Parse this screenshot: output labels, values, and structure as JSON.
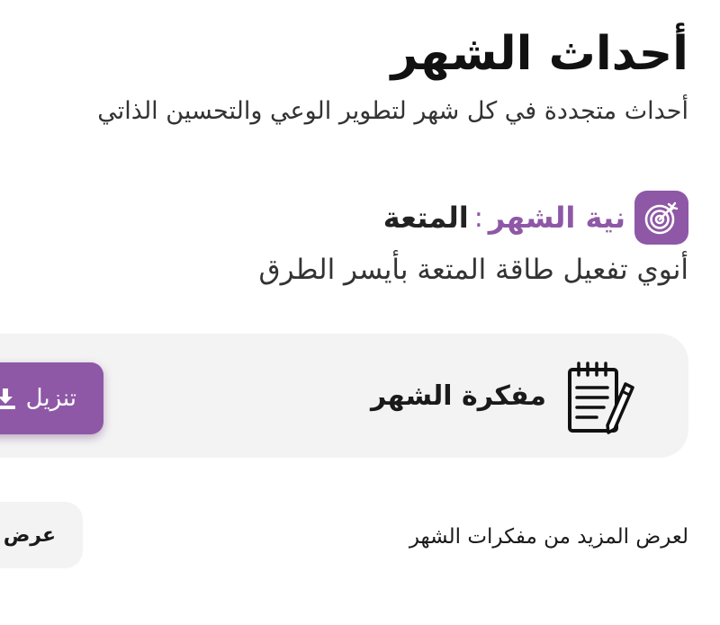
{
  "header": {
    "title": "أحداث الشهر",
    "subtitle": "أحداث متجددة في كل شهر لتطوير الوعي والتحسين الذاتي"
  },
  "intention": {
    "icon": "target-icon",
    "label": "نية الشهر",
    "colon": ":",
    "value": "المتعة",
    "text": "أنوي تفعيل طاقة المتعة بأيسر الطرق"
  },
  "notebook": {
    "icon": "notepad-pencil-icon",
    "title": "مفكرة الشهر",
    "download_label": "تنزيل",
    "download_icon": "download-icon"
  },
  "more": {
    "text": "لعرض المزيد من مفكرات الشهر",
    "view_label": "عرض",
    "view_icon": "chevron-left-icon"
  },
  "colors": {
    "accent": "#8e58a6",
    "card_bg": "#f3f3f3",
    "text": "#1a1a1a"
  }
}
